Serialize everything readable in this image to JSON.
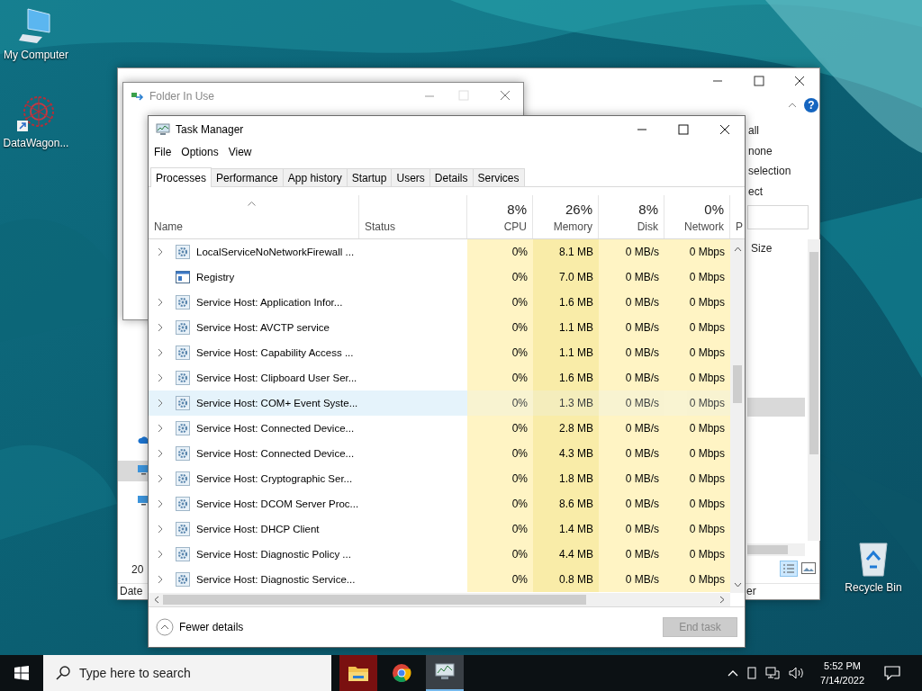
{
  "desktop": {
    "icons": [
      {
        "label": "My Computer",
        "kind": "computer"
      },
      {
        "label": "DataWagon...",
        "kind": "shortcut"
      },
      {
        "label": "Recycle Bin",
        "kind": "recycle"
      }
    ]
  },
  "explorer": {
    "ribbon_labels": [
      "all",
      "none",
      "selection",
      "ect"
    ],
    "help_glyph": "?",
    "column_header": "Size",
    "item_count": "20",
    "status_left": "Date",
    "status_right": "er"
  },
  "folder_in_use": {
    "title": "Folder In Use"
  },
  "task_manager": {
    "title": "Task Manager",
    "menu": [
      "File",
      "Options",
      "View"
    ],
    "tabs": [
      {
        "label": "Processes",
        "selected": true
      },
      {
        "label": "Performance",
        "selected": false
      },
      {
        "label": "App history",
        "selected": false
      },
      {
        "label": "Startup",
        "selected": false
      },
      {
        "label": "Users",
        "selected": false
      },
      {
        "label": "Details",
        "selected": false
      },
      {
        "label": "Services",
        "selected": false
      }
    ],
    "columns": [
      {
        "kind": "name",
        "label": "Name"
      },
      {
        "kind": "text",
        "label": "Status"
      },
      {
        "kind": "metric",
        "usage": "8%",
        "label": "CPU",
        "color": "#fff4c4"
      },
      {
        "kind": "metric",
        "usage": "26%",
        "label": "Memory",
        "color": "#f9eca8"
      },
      {
        "kind": "metric",
        "usage": "8%",
        "label": "Disk",
        "color": "#fff4c4"
      },
      {
        "kind": "metric",
        "usage": "0%",
        "label": "Network",
        "color": "#fff4c4"
      },
      {
        "kind": "cut",
        "label": "P"
      }
    ],
    "rows": [
      {
        "name": "LocalServiceNoNetworkFirewall ...",
        "kind": "service",
        "expandable": true,
        "highlighted": false,
        "values": [
          "0%",
          "8.1 MB",
          "0 MB/s",
          "0 Mbps"
        ]
      },
      {
        "name": "Registry",
        "kind": "registry",
        "expandable": false,
        "highlighted": false,
        "values": [
          "0%",
          "7.0 MB",
          "0 MB/s",
          "0 Mbps"
        ]
      },
      {
        "name": "Service Host: Application Infor...",
        "kind": "service",
        "expandable": true,
        "highlighted": false,
        "values": [
          "0%",
          "1.6 MB",
          "0 MB/s",
          "0 Mbps"
        ]
      },
      {
        "name": "Service Host: AVCTP service",
        "kind": "service",
        "expandable": true,
        "highlighted": false,
        "values": [
          "0%",
          "1.1 MB",
          "0 MB/s",
          "0 Mbps"
        ]
      },
      {
        "name": "Service Host: Capability Access ...",
        "kind": "service",
        "expandable": true,
        "highlighted": false,
        "values": [
          "0%",
          "1.1 MB",
          "0 MB/s",
          "0 Mbps"
        ]
      },
      {
        "name": "Service Host: Clipboard User Ser...",
        "kind": "service",
        "expandable": true,
        "highlighted": false,
        "values": [
          "0%",
          "1.6 MB",
          "0 MB/s",
          "0 Mbps"
        ]
      },
      {
        "name": "Service Host: COM+ Event Syste...",
        "kind": "service",
        "expandable": true,
        "highlighted": true,
        "values": [
          "0%",
          "1.3 MB",
          "0 MB/s",
          "0 Mbps"
        ]
      },
      {
        "name": "Service Host: Connected Device...",
        "kind": "service",
        "expandable": true,
        "highlighted": false,
        "values": [
          "0%",
          "2.8 MB",
          "0 MB/s",
          "0 Mbps"
        ]
      },
      {
        "name": "Service Host: Connected Device...",
        "kind": "service",
        "expandable": true,
        "highlighted": false,
        "values": [
          "0%",
          "4.3 MB",
          "0 MB/s",
          "0 Mbps"
        ]
      },
      {
        "name": "Service Host: Cryptographic Ser...",
        "kind": "service",
        "expandable": true,
        "highlighted": false,
        "values": [
          "0%",
          "1.8 MB",
          "0 MB/s",
          "0 Mbps"
        ]
      },
      {
        "name": "Service Host: DCOM Server Proc...",
        "kind": "service",
        "expandable": true,
        "highlighted": false,
        "values": [
          "0%",
          "8.6 MB",
          "0 MB/s",
          "0 Mbps"
        ]
      },
      {
        "name": "Service Host: DHCP Client",
        "kind": "service",
        "expandable": true,
        "highlighted": false,
        "values": [
          "0%",
          "1.4 MB",
          "0 MB/s",
          "0 Mbps"
        ]
      },
      {
        "name": "Service Host: Diagnostic Policy ...",
        "kind": "service",
        "expandable": true,
        "highlighted": false,
        "values": [
          "0%",
          "4.4 MB",
          "0 MB/s",
          "0 Mbps"
        ]
      },
      {
        "name": "Service Host: Diagnostic Service...",
        "kind": "service",
        "expandable": true,
        "highlighted": false,
        "values": [
          "0%",
          "0.8 MB",
          "0 MB/s",
          "0 Mbps"
        ]
      }
    ],
    "footer": {
      "toggle": "Fewer details",
      "end_task": {
        "label": "End task",
        "disabled": true
      }
    }
  },
  "taskbar": {
    "search": {
      "placeholder": "Type here to search"
    },
    "apps": [
      {
        "kind": "explorer",
        "active": false,
        "flashing": true
      },
      {
        "kind": "browser",
        "active": false,
        "flashing": false
      },
      {
        "kind": "monitor",
        "active": true,
        "flashing": false
      }
    ],
    "time": "5:52 PM",
    "date": "7/14/2022"
  }
}
